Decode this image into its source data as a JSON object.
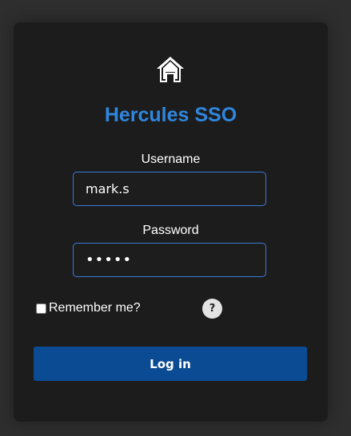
{
  "app": {
    "title": "Hercules SSO",
    "brand_color": "#2f86de",
    "logo_icon": "home-icon"
  },
  "form": {
    "username_label": "Username",
    "username_value": "mark.s",
    "password_label": "Password",
    "password_value": "•••••",
    "remember_label": "Remember me?",
    "remember_checked": false,
    "help_icon": "?",
    "login_label": "Log in",
    "button_color": "#0b4b94"
  }
}
